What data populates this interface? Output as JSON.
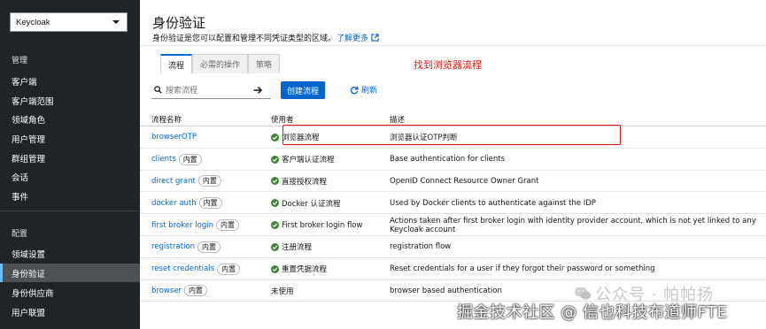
{
  "sidebar": {
    "realm": "Keycloak",
    "manage_title": "管理",
    "manage_items": [
      "客户端",
      "客户端范围",
      "领域角色",
      "用户管理",
      "群组管理",
      "会话",
      "事件"
    ],
    "config_title": "配置",
    "config_items": [
      "领域设置",
      "身份验证",
      "身份供应商",
      "用户联盟"
    ],
    "active_item": "身份验证"
  },
  "header": {
    "title": "身份验证",
    "description": "身份验证是您可以配置和管理不同凭证类型的区域。",
    "learn_more": "了解更多"
  },
  "tabs": [
    "流程",
    "必需的操作",
    "策略"
  ],
  "annotation": "找到浏览器流程",
  "toolbar": {
    "search_placeholder": "搜索流程",
    "create_label": "创建流程",
    "refresh_label": "刷新"
  },
  "table": {
    "headers": [
      "流程名称",
      "使用者",
      "描述"
    ],
    "builtin_badge": "内置",
    "rows": [
      {
        "name": "browserOTP",
        "builtin": false,
        "used": "浏览器流程",
        "used_check": true,
        "desc": "浏览器认证OTP判断"
      },
      {
        "name": "clients",
        "builtin": true,
        "used": "客户端认证流程",
        "used_check": true,
        "desc": "Base authentication for clients"
      },
      {
        "name": "direct grant",
        "builtin": true,
        "used": "直接授权流程",
        "used_check": true,
        "desc": "OpenID Connect Resource Owner Grant"
      },
      {
        "name": "docker auth",
        "builtin": true,
        "used": "Docker 认证流程",
        "used_check": true,
        "desc": "Used by Docker clients to authenticate against the IDP"
      },
      {
        "name": "first broker login",
        "builtin": true,
        "used": "First broker login flow",
        "used_check": true,
        "desc": "Actions taken after first broker login with identity provider account, which is not yet linked to any Keycloak account"
      },
      {
        "name": "registration",
        "builtin": true,
        "used": "注册流程",
        "used_check": true,
        "desc": "registration flow"
      },
      {
        "name": "reset credentials",
        "builtin": true,
        "used": "重置凭据流程",
        "used_check": true,
        "desc": "Reset credentials for a user if they forgot their password or something"
      },
      {
        "name": "browser",
        "builtin": true,
        "used": "未使用",
        "used_check": false,
        "desc": "browser based authentication"
      }
    ]
  },
  "watermark": {
    "wechat": "公众号 · 帕帕扬",
    "juejin": "掘金技术社区 @ 信也科技布道师FTE"
  },
  "colors": {
    "sidebar_bg": "#212427",
    "accent": "#0066cc",
    "success": "#3e8635",
    "annotation": "#e8150b"
  }
}
